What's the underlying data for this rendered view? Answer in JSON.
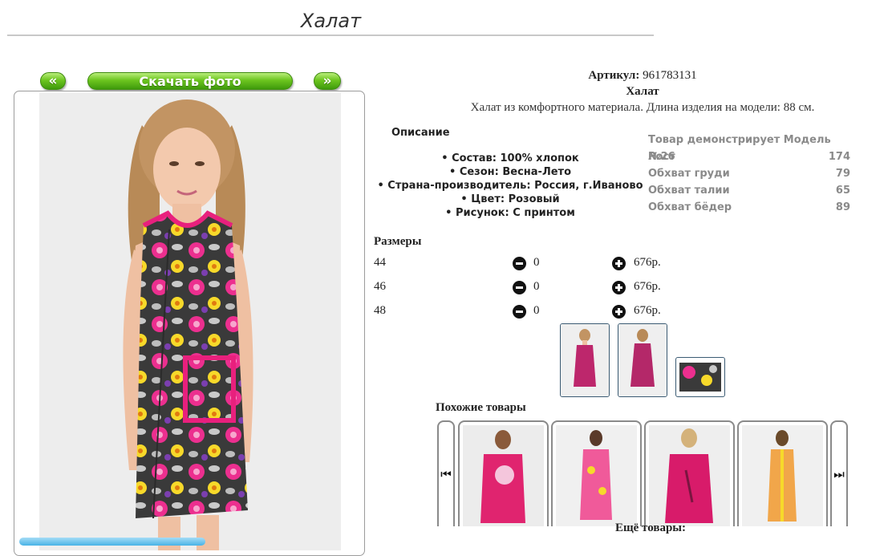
{
  "page": {
    "title": "Халат"
  },
  "nav": {
    "prev": "«",
    "download": "Скачать фото",
    "next": "»"
  },
  "product": {
    "article_label": "Артикул:",
    "article_value": "961783131",
    "name": "Халат",
    "description": "Халат из комфортного материала. Длина изделия на модели: 88 см."
  },
  "specs": {
    "heading": "Описание",
    "items": [
      "Состав: 100% хлопок",
      "Сезон: Весна-Лето",
      "Страна-производитель: Россия, г.Иваново",
      "Цвет: Розовый",
      "Рисунок: С принтом"
    ]
  },
  "model": {
    "heading": "Товар демонстрирует Модель №26",
    "rows": [
      {
        "label": "Рост",
        "value": "174"
      },
      {
        "label": "Обхват груди",
        "value": "79"
      },
      {
        "label": "Обхват талии",
        "value": "65"
      },
      {
        "label": "Обхват бёдер",
        "value": "89"
      }
    ]
  },
  "sizes": {
    "heading": "Размеры",
    "rows": [
      {
        "size": "44",
        "qty": "0",
        "price": "676р."
      },
      {
        "size": "46",
        "qty": "0",
        "price": "676р."
      },
      {
        "size": "48",
        "qty": "0",
        "price": "676р."
      }
    ]
  },
  "similar": {
    "heading": "Похожие товары",
    "prev_icon": "⏮",
    "next_icon": "⏭"
  },
  "more": {
    "heading": "Ещё товары:"
  },
  "colors": {
    "accent_green": "#5cb81a",
    "dress_pink": "#e8207d",
    "frame_border": "#9c9c9c"
  }
}
